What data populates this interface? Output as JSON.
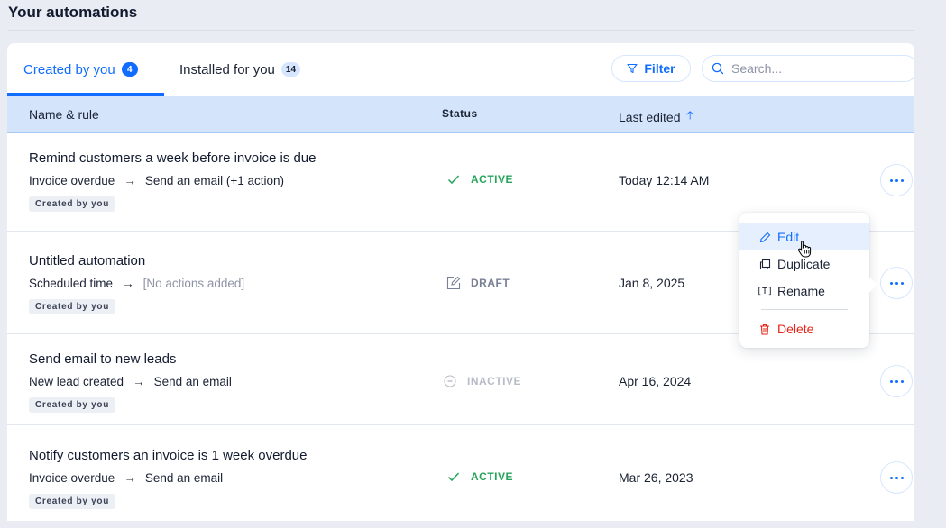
{
  "page": {
    "title": "Your automations"
  },
  "tabs": [
    {
      "label": "Created by you",
      "count": "4",
      "active": true
    },
    {
      "label": "Installed for you",
      "count": "14",
      "active": false
    }
  ],
  "toolbar": {
    "filter_label": "Filter",
    "search_placeholder": "Search...",
    "search_value": ""
  },
  "table": {
    "columns": {
      "name": "Name & rule",
      "status": "Status",
      "last_edited": "Last edited",
      "sort_icon": "arrow-up-icon"
    },
    "rows": [
      {
        "name": "Remind customers a week before invoice is due",
        "trigger": "Invoice overdue",
        "arrow": "→",
        "action": "Send an email (+1 action)",
        "tag": "Created by you",
        "status": "ACTIVE",
        "status_icon": "check-icon",
        "last_edited": "Today 12:14 AM"
      },
      {
        "name": "Untitled automation",
        "trigger": "Scheduled time",
        "arrow": "→",
        "action": "[No actions added]",
        "tag": "Created by you",
        "status": "DRAFT",
        "status_icon": "draft-edit-icon",
        "last_edited": "Jan 8, 2025"
      },
      {
        "name": "Send email to new leads",
        "trigger": "New lead created",
        "arrow": "→",
        "action": "Send an email",
        "tag": "Created by you",
        "status": "INACTIVE",
        "status_icon": "minus-circle-icon",
        "last_edited": "Apr 16, 2024"
      },
      {
        "name": "Notify customers an invoice is 1 week overdue",
        "trigger": "Invoice overdue",
        "arrow": "→",
        "action": "Send an email",
        "tag": "Created by you",
        "status": "ACTIVE",
        "status_icon": "check-icon",
        "last_edited": "Mar 26, 2023"
      }
    ]
  },
  "context_menu": {
    "items": [
      {
        "label": "Edit",
        "icon": "pencil-icon",
        "highlighted": true
      },
      {
        "label": "Duplicate",
        "icon": "duplicate-icon"
      },
      {
        "label": "Rename",
        "icon": "rename-icon"
      },
      {
        "label": "Delete",
        "icon": "trash-icon",
        "destructive": true
      }
    ]
  },
  "colors": {
    "accent": "#116dff",
    "header_bg": "#d4e4fb",
    "active": "#25a55a",
    "draft": "#7a8196",
    "inactive": "#b8bcc8",
    "danger": "#e62214",
    "page_bg": "#e9ecf2"
  }
}
